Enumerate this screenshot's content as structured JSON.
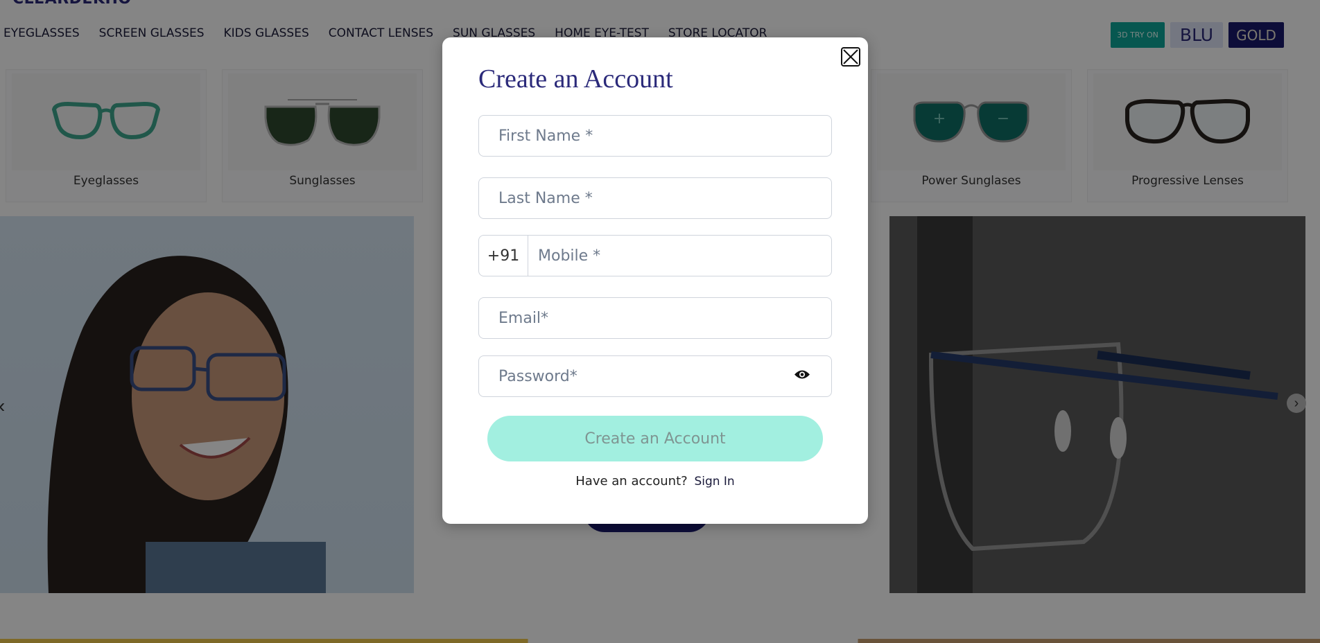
{
  "header": {
    "logo": "CLEARDEKHO",
    "nav": [
      "EYEGLASSES",
      "SCREEN GLASSES",
      "KIDS GLASSES",
      "CONTACT LENSES",
      "SUN GLASSES",
      "HOME EYE-TEST",
      "STORE LOCATOR"
    ],
    "try_on": "3D TRY ON",
    "blu": "BLU",
    "gold": "GOLD"
  },
  "categories": [
    {
      "label": "Eyeglasses"
    },
    {
      "label": "Sunglasses"
    },
    {
      "label": "Power Sunglases"
    },
    {
      "label": "Progressive Lenses"
    }
  ],
  "modal": {
    "title": "Create an Account",
    "first_name_placeholder": "First Name *",
    "last_name_placeholder": "Last Name *",
    "country_code": "+91",
    "mobile_placeholder": "Mobile *",
    "email_placeholder": "Email*",
    "password_placeholder": "Password*",
    "submit_label": "Create an Account",
    "have_account": "Have an account?",
    "sign_in": "Sign In"
  },
  "colors": {
    "brand_navy": "#2b2a7a",
    "teal": "#0fa89a",
    "submit_disabled": "#a2efe0"
  }
}
